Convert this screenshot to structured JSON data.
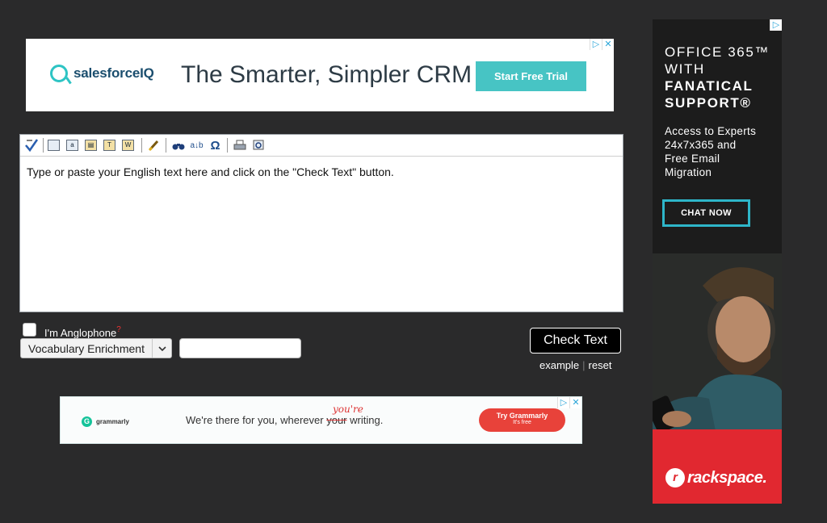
{
  "ad_top": {
    "brand": "salesforceIQ",
    "tagline": "The Smarter, Simpler CRM",
    "cta": "Start Free Trial"
  },
  "editor": {
    "toolbar_icons": [
      "spellcheck-icon",
      "copy-icon",
      "select-all-icon",
      "paste-icon",
      "paste-text-icon",
      "paste-word-icon",
      "clear-format-icon",
      "find-icon",
      "replace-icon",
      "special-char-icon",
      "print-icon",
      "preview-icon"
    ],
    "text": "Type or paste your English text here and click on the \"Check Text\" button."
  },
  "controls": {
    "anglophone_label": "I'm Anglophone",
    "anglophone_help": "?",
    "mode_select": "Vocabulary Enrichment",
    "check_button": "Check Text",
    "example_link": "example",
    "link_separator": "|",
    "reset_link": "reset"
  },
  "ad_mid": {
    "brand": "grammarly",
    "tagline_before": "We're there for you, wherever ",
    "tagline_strike": "your",
    "tagline_after": " writing.",
    "correction": "you're",
    "cta_line1": "Try Grammarly",
    "cta_line2": "It's free"
  },
  "ad_side": {
    "title_line1": "OFFICE 365™",
    "title_line2": "WITH",
    "title_line3": "FANATICAL",
    "title_line4": "SUPPORT®",
    "body_line1": "Access to Experts",
    "body_line2": "24x7x365 and",
    "body_line3": "Free Email",
    "body_line4": "Migration",
    "cta": "CHAT NOW",
    "brand": "rackspace."
  },
  "colors": {
    "page_bg": "#2a2a2b",
    "salesforce_accent": "#47c4c4",
    "grammarly_red": "#e8423a",
    "rackspace_red": "#e12830",
    "rackspace_cta_border": "#2eb6c9"
  }
}
